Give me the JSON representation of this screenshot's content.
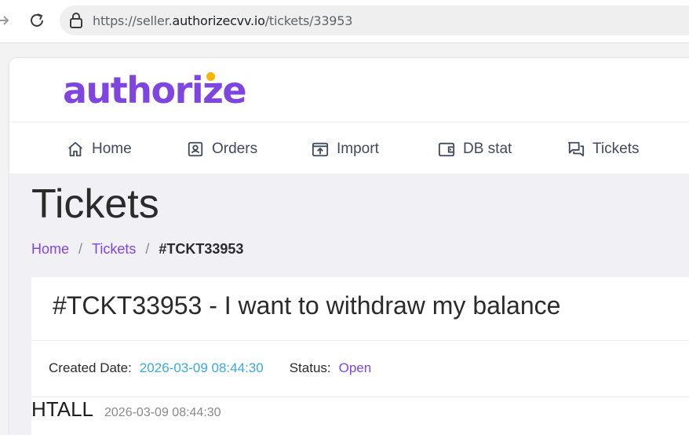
{
  "browser": {
    "url_prefix": "https://seller.",
    "url_domain": "authorizecvv.io",
    "url_path": "/tickets/33953"
  },
  "app": {
    "logo_text": "authorize",
    "brand_color": "#7e45e0",
    "accent_dot_color": "#f7b500"
  },
  "menu": {
    "items": [
      {
        "label": "Home",
        "icon": "home-icon"
      },
      {
        "label": "Orders",
        "icon": "orders-icon"
      },
      {
        "label": "Import",
        "icon": "import-icon"
      },
      {
        "label": "DB stat",
        "icon": "wallet-icon"
      },
      {
        "label": "Tickets",
        "icon": "chat-icon"
      }
    ]
  },
  "page": {
    "title": "Tickets",
    "breadcrumb": {
      "home": "Home",
      "tickets": "Tickets",
      "separator": "/",
      "current": "#TCKT33953"
    }
  },
  "ticket": {
    "heading": "#TCKT33953 - I want to withdraw my balance",
    "created_label": "Created Date:",
    "created_value": "2026-03-09 08:44:30",
    "status_label": "Status:",
    "status_value": "Open",
    "message": {
      "author": "HTALL",
      "date": "2026-03-09 08:44:30"
    }
  }
}
